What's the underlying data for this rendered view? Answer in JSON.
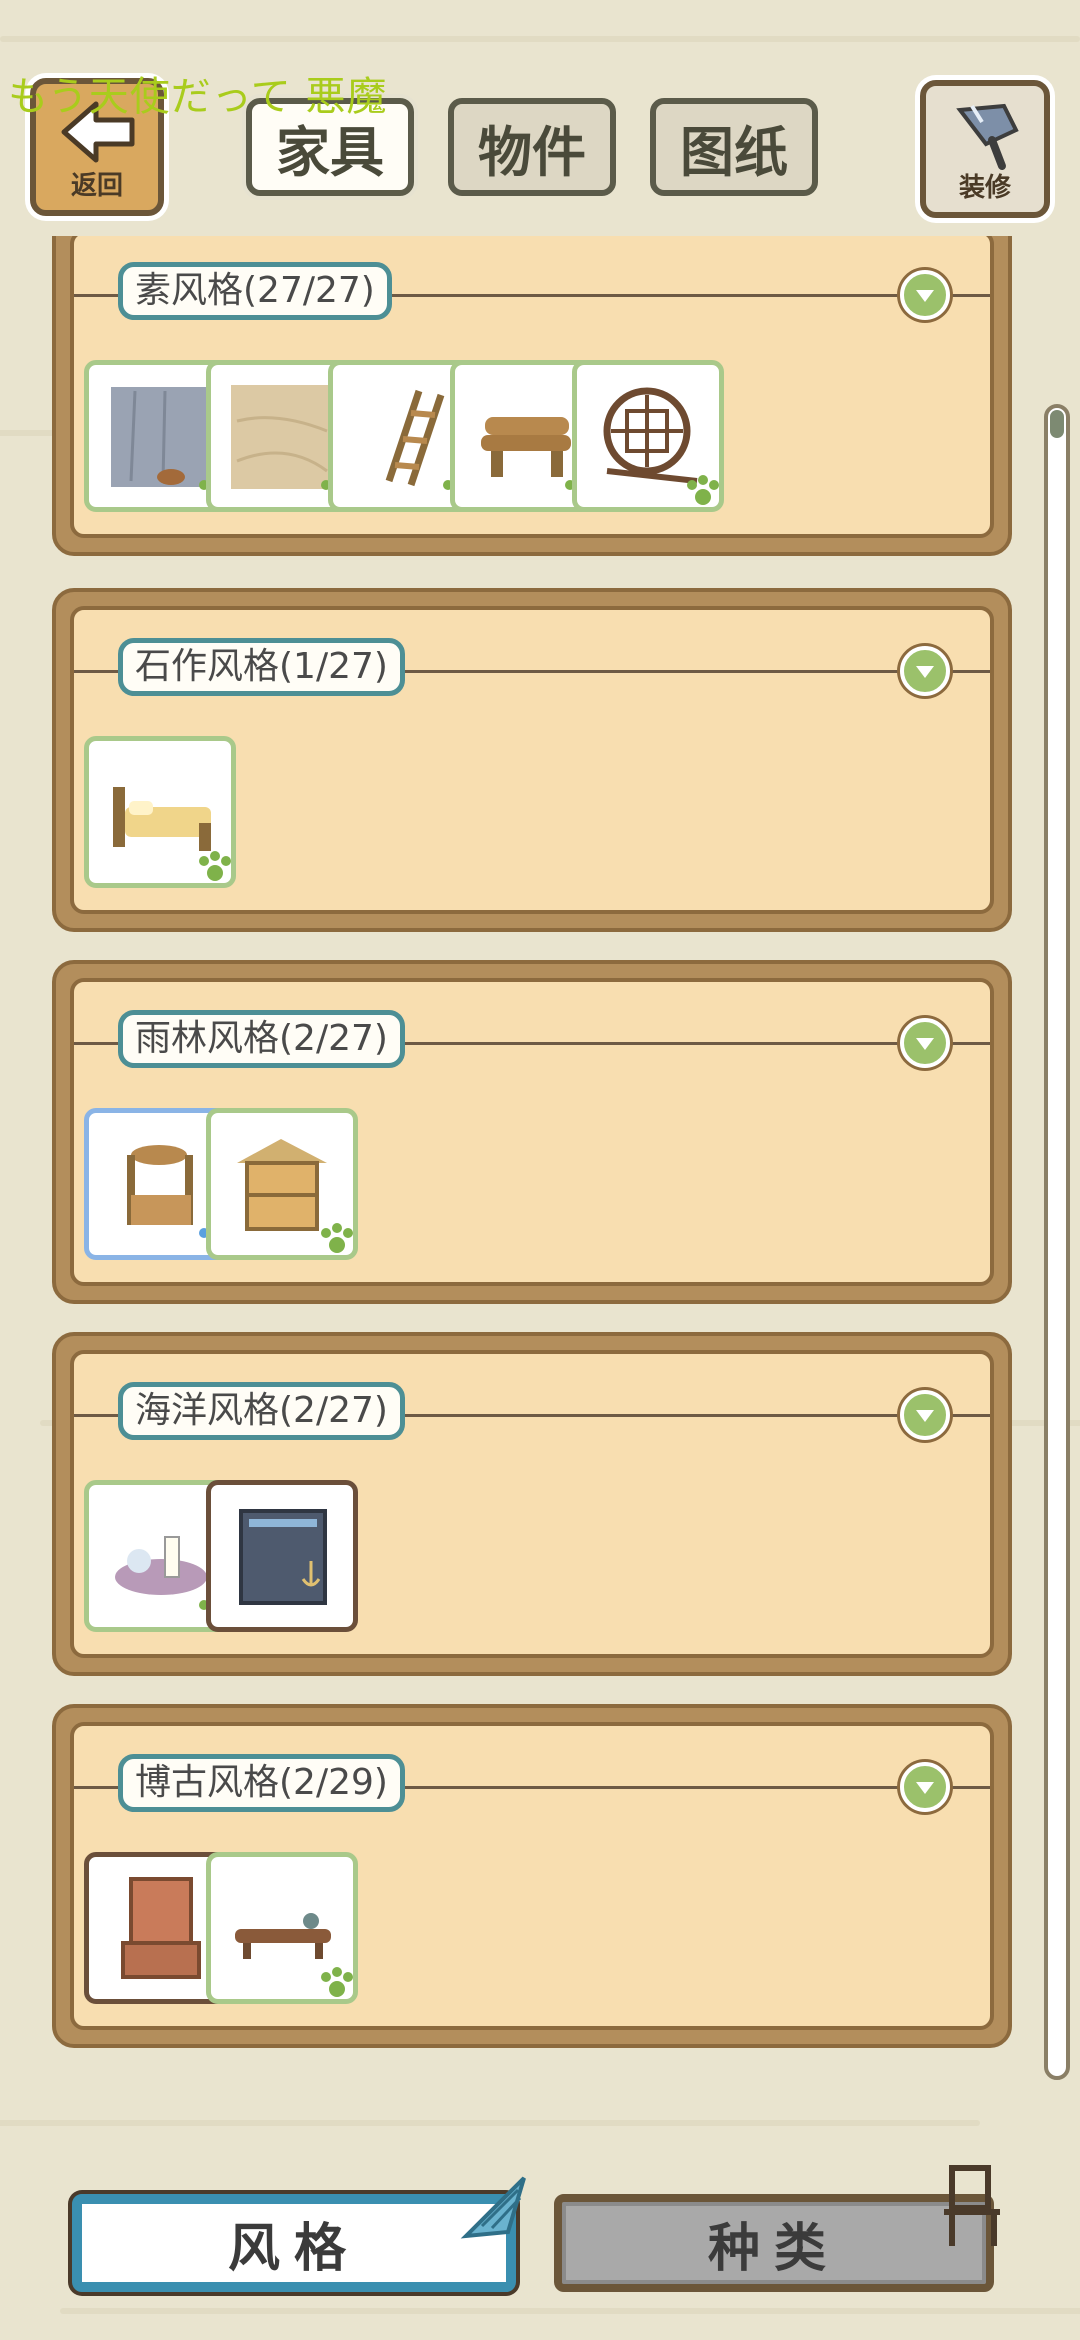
{
  "overlay_text": "もう天使だって 悪魔",
  "header": {
    "back_label": "返回",
    "tabs": [
      {
        "label": "家具",
        "active": true
      },
      {
        "label": "物件",
        "active": false
      },
      {
        "label": "图纸",
        "active": false
      }
    ],
    "decorate_label": "装修"
  },
  "sections": [
    {
      "title": "素风格(27/27)",
      "items": [
        {
          "name": "stone-wall-with-bucket",
          "frame": "green",
          "paw": "green"
        },
        {
          "name": "sand-floor",
          "frame": "green",
          "paw": "green"
        },
        {
          "name": "wooden-ladder",
          "frame": "green",
          "paw": "green"
        },
        {
          "name": "log-bench",
          "frame": "green",
          "paw": "green"
        },
        {
          "name": "round-lattice-window",
          "frame": "green",
          "paw": "green"
        }
      ]
    },
    {
      "title": "石作风格(1/27)",
      "items": [
        {
          "name": "wooden-bed",
          "frame": "green",
          "paw": "green"
        }
      ]
    },
    {
      "title": "雨林风格(2/27)",
      "items": [
        {
          "name": "mirror-vanity",
          "frame": "blue",
          "paw": "blue"
        },
        {
          "name": "thatched-shelf",
          "frame": "green",
          "paw": "green"
        }
      ]
    },
    {
      "title": "海洋风格(2/27)",
      "items": [
        {
          "name": "shell-candle",
          "frame": "green",
          "paw": "green"
        },
        {
          "name": "anchor-cabinet",
          "frame": "brown",
          "paw": "none"
        }
      ]
    },
    {
      "title": "博古风格(2/29)",
      "items": [
        {
          "name": "antique-cabinet",
          "frame": "brown",
          "paw": "none"
        },
        {
          "name": "low-tea-table",
          "frame": "green",
          "paw": "green"
        }
      ]
    }
  ],
  "bottom_tabs": [
    {
      "label": "风格",
      "active": true
    },
    {
      "label": "种类",
      "active": false
    }
  ],
  "colors": {
    "background": "#e9e4cf",
    "panel": "#f8deb0",
    "frame_green": "#a9c98a",
    "frame_blue": "#8ab4e6",
    "accent_blue": "#3a8fb0"
  }
}
